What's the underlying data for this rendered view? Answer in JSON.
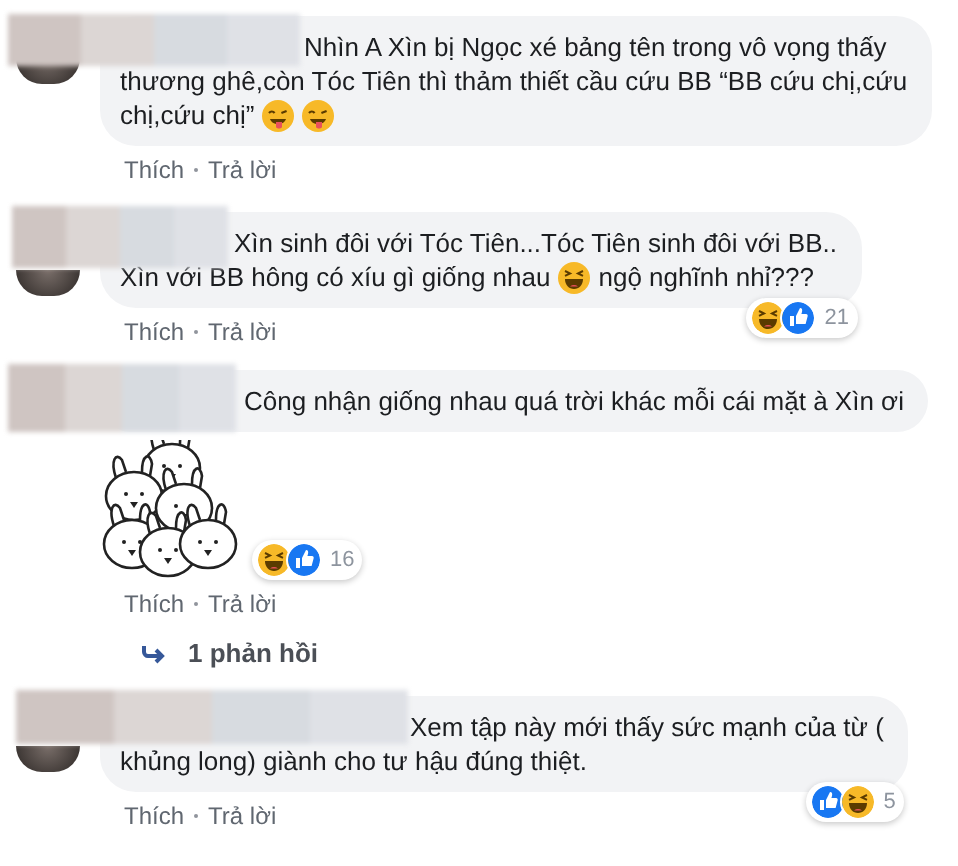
{
  "comments": [
    {
      "lines": [
        [
          {
            "kind": "text",
            "text": "Nhìn A Xìn bị Ngọc xé bảng tên trong vô vọng thấy"
          }
        ],
        [
          {
            "kind": "text",
            "text": "thương ghê,còn Tóc Tiên thì thảm thiết cầu cứu BB “BB cứu chị,cứu"
          }
        ],
        [
          {
            "kind": "text",
            "text": "chị,cứu chị”"
          },
          {
            "kind": "tongue"
          },
          {
            "kind": "tongue"
          }
        ]
      ],
      "actions": [
        "Thích",
        "Trả lời"
      ]
    },
    {
      "lines": [
        [
          {
            "kind": "text",
            "text": "Xìn sinh đôi với Tóc Tiên...Tóc Tiên sinh đôi với BB.."
          }
        ],
        [
          {
            "kind": "text",
            "text": "Xìn với BB hông có xíu gì giống nhau"
          },
          {
            "kind": "laugh"
          },
          {
            "kind": "text",
            "text": "ngộ nghĩnh nhỉ???"
          }
        ]
      ],
      "reaction_count": "21",
      "actions": [
        "Thích",
        "Trả lời"
      ]
    },
    {
      "lines": [
        [
          {
            "kind": "text",
            "text": "Công nhận giống nhau quá trời khác mỗi cái mặt à Xìn ơi"
          }
        ]
      ],
      "attachment": {
        "kind": "sticker"
      },
      "reaction_count": "16",
      "actions": [
        "Thích",
        "Trả lời"
      ],
      "replies": "1 phản hồi"
    },
    {
      "lines": [
        [
          {
            "kind": "text",
            "text": "Xem tập này mới thấy sức mạnh của từ ("
          }
        ],
        [
          {
            "kind": "text",
            "text": "khủng long) giành cho tư hậu đúng thiệt."
          }
        ]
      ],
      "reaction_count": "5",
      "actions": [
        "Thích",
        "Trả lời"
      ]
    }
  ]
}
